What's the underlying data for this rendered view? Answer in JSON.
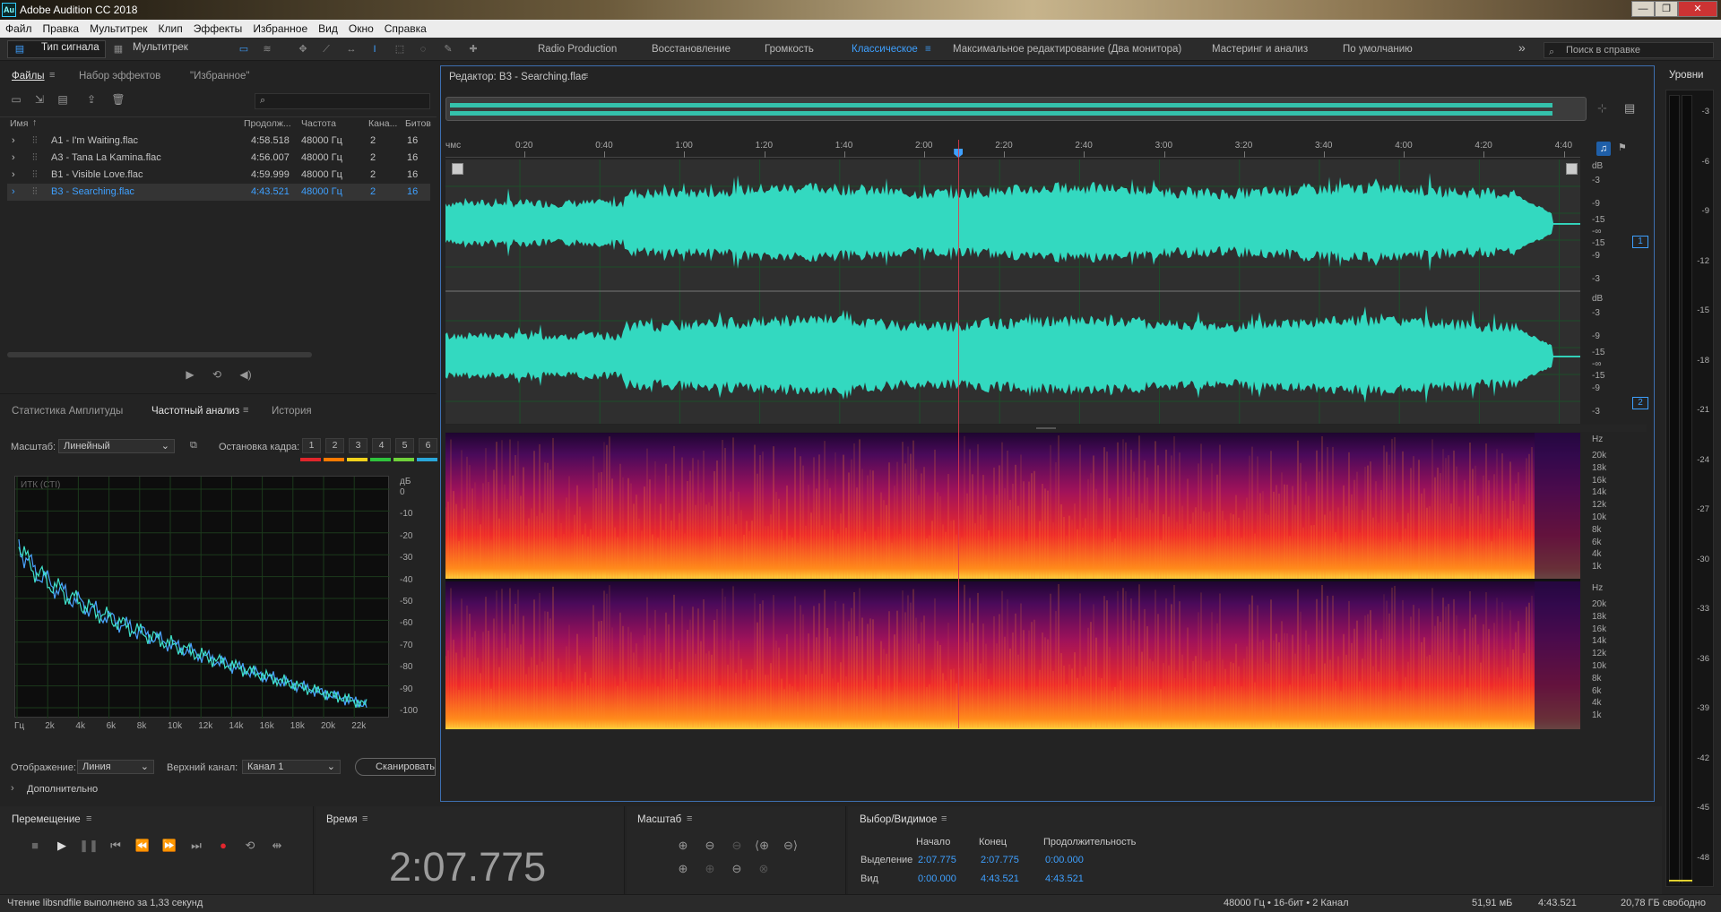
{
  "window": {
    "title": "Adobe Audition CC 2018",
    "icon": "Au"
  },
  "menu": [
    "Файл",
    "Правка",
    "Мультитрек",
    "Клип",
    "Эффекты",
    "Избранное",
    "Вид",
    "Окно",
    "Справка"
  ],
  "toolbar": {
    "waveform_label": "Тип сигнала",
    "multitrack_label": "Мультитрек",
    "workspaces": [
      "Radio Production",
      "Восстановление",
      "Громкость",
      "Классическое",
      "Максимальное редактирование (Два монитора)",
      "Мастеринг и анализ",
      "По умолчанию"
    ],
    "active_workspace": "Классическое",
    "search_placeholder": "Поиск в справке"
  },
  "files_panel": {
    "tabs": [
      "Файлы",
      "Набор эффектов",
      "\"Избранное\""
    ],
    "columns": [
      "Имя",
      "Продолж...",
      "Частота",
      "Кана...",
      "Битов"
    ],
    "files": [
      {
        "name": "A1 - I'm Waiting.flac",
        "duration": "4:58.518",
        "rate": "48000 Гц",
        "channels": "2",
        "bits": "16"
      },
      {
        "name": "A3 - Tana La Kamina.flac",
        "duration": "4:56.007",
        "rate": "48000 Гц",
        "channels": "2",
        "bits": "16"
      },
      {
        "name": "B1 - Visible Love.flac",
        "duration": "4:59.999",
        "rate": "48000 Гц",
        "channels": "2",
        "bits": "16"
      },
      {
        "name": "B3 - Searching.flac",
        "duration": "4:43.521",
        "rate": "48000 Гц",
        "channels": "2",
        "bits": "16"
      }
    ]
  },
  "analysis_panel": {
    "tabs": [
      "Статистика Амплитуды",
      "Частотный анализ",
      "История"
    ],
    "scale_label": "Масштаб:",
    "scale_value": "Линейный",
    "freeze_label": "Остановка кадра:",
    "freeze_slots": [
      "1",
      "2",
      "3",
      "4",
      "5",
      "6"
    ],
    "freeze_colors": [
      "#e0262b",
      "#ff7a00",
      "#f2d21c",
      "#2fc33c",
      "#6fd13b",
      "#2aa6d9"
    ],
    "graph_label": "ИТК (СТI)",
    "db_unit": "дБ",
    "db_ticks": [
      "0",
      "-10",
      "-20",
      "-30",
      "-40",
      "-50",
      "-60",
      "-70",
      "-80",
      "-90",
      "-100"
    ],
    "freq_ticks": [
      "Гц",
      "2k",
      "4k",
      "6k",
      "8k",
      "10k",
      "12k",
      "14k",
      "16k",
      "18k",
      "20k",
      "22k"
    ],
    "display_label": "Отображение:",
    "display_value": "Линия",
    "channel_label": "Верхний канал:",
    "channel_value": "Канал 1",
    "scan_label": "Сканировать",
    "advanced_label": "Дополнительно"
  },
  "editor": {
    "title": "Редактор: B3 - Searching.flac",
    "ruler_unit": "чмс",
    "ruler_ticks": [
      "0:20",
      "0:40",
      "1:00",
      "1:20",
      "1:40",
      "2:00",
      "2:20",
      "2:40",
      "3:00",
      "3:20",
      "3:40",
      "4:00",
      "4:20",
      "4:40"
    ],
    "db_unit": "dB",
    "db_labels": [
      "-3",
      "-9",
      "-15",
      "-∞",
      "-15",
      "-9",
      "-3"
    ],
    "channels": [
      "1",
      "2"
    ],
    "hz_unit": "Hz",
    "hz_labels": [
      "20k",
      "18k",
      "16k",
      "14k",
      "12k",
      "10k",
      "8k",
      "6k",
      "4k",
      "1k"
    ],
    "playhead_fraction": 0.452
  },
  "levels": {
    "title": "Уровни",
    "labels": [
      "-3",
      "-6",
      "-9",
      "-12",
      "-15",
      "-18",
      "-21",
      "-24",
      "-27",
      "-30",
      "-33",
      "-36",
      "-39",
      "-42",
      "-45",
      "-48"
    ]
  },
  "transport": {
    "title": "Перемещение"
  },
  "time": {
    "title": "Время",
    "value": "2:07.775"
  },
  "zoom": {
    "title": "Масштаб"
  },
  "selection": {
    "title": "Выбор/Видимое",
    "col_start": "Начало",
    "col_end": "Конец",
    "col_duration": "Продолжительность",
    "row_selection": "Выделение",
    "row_view": "Вид",
    "sel_start": "2:07.775",
    "sel_end": "2:07.775",
    "sel_duration": "0:00.000",
    "view_start": "0:00.000",
    "view_end": "4:43.521",
    "view_duration": "4:43.521"
  },
  "status": {
    "message": "Чтение libsndfile выполнено за 1,33 секунд",
    "format": "48000 Гц • 16-бит • 2 Канал",
    "size": "51,91 мБ",
    "duration": "4:43.521",
    "free": "20,78 ГБ свободно"
  },
  "colors": {
    "waveform": "#33d9c0",
    "accent": "#3ea0ff",
    "playhead": "#e0394b"
  }
}
